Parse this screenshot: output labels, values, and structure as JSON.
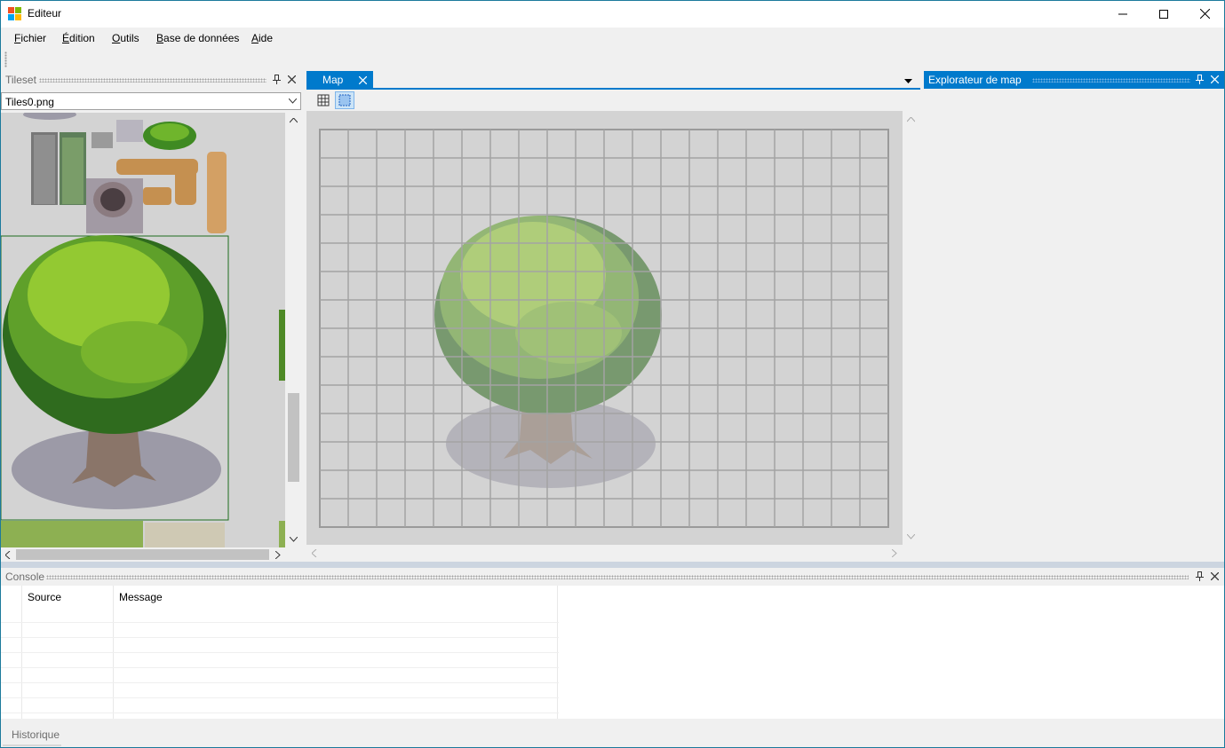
{
  "window": {
    "title": "Editeur",
    "minimize": "—",
    "maximize": "☐",
    "close": "✕"
  },
  "menu": [
    {
      "u": "F",
      "rest": "ichier"
    },
    {
      "u": "É",
      "rest": "dition"
    },
    {
      "u": "O",
      "rest": "utils"
    },
    {
      "u": "B",
      "rest": "ase de données"
    },
    {
      "u": "A",
      "rest": "ide"
    }
  ],
  "tileset": {
    "title": "Tileset",
    "file": "Tiles0.png",
    "pin": "📌",
    "close": "✕"
  },
  "map": {
    "tab_label": "Map",
    "tab_close": "✕",
    "dropdown": "▾"
  },
  "explorer": {
    "title": "Explorateur de map"
  },
  "console": {
    "title": "Console",
    "col_source": "Source",
    "col_message": "Message"
  },
  "history": {
    "label": "Historique"
  },
  "colors": {
    "accent": "#007acc",
    "tree_dark": "#2f6b1e",
    "tree_light": "#b5d936",
    "trunk": "#8a7569",
    "shadow": "#9c9aa7"
  }
}
